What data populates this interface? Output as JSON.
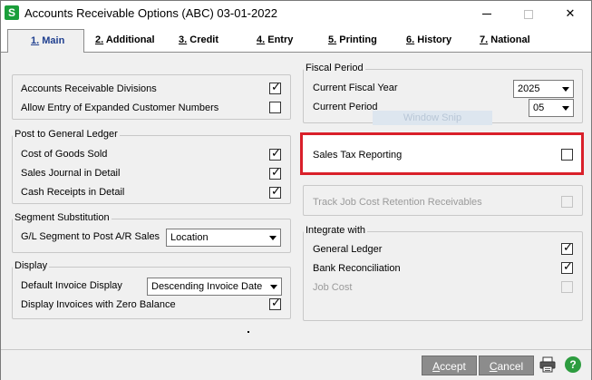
{
  "window": {
    "app_icon": "S",
    "title": "Accounts Receivable Options (ABC) 03-01-2022"
  },
  "tabs": [
    {
      "key": "1.",
      "label": " Main",
      "active": true
    },
    {
      "key": "2.",
      "label": " Additional"
    },
    {
      "key": "3.",
      "label": " Credit"
    },
    {
      "key": "4.",
      "label": " Entry"
    },
    {
      "key": "5.",
      "label": " Printing"
    },
    {
      "key": "6.",
      "label": " History"
    },
    {
      "key": "7.",
      "label": " National"
    }
  ],
  "general": {
    "ar_divisions_label": "Accounts Receivable Divisions",
    "ar_divisions_checked": true,
    "expanded_customer_label": "Allow Entry of Expanded Customer Numbers",
    "expanded_customer_checked": false
  },
  "post_gl": {
    "title": "Post to General Ledger",
    "cogs_label": "Cost of Goods Sold",
    "cogs_checked": true,
    "sales_journal_label": "Sales Journal in Detail",
    "sales_journal_checked": true,
    "cash_receipts_label": "Cash Receipts in Detail",
    "cash_receipts_checked": true
  },
  "segment": {
    "title": "Segment Substitution",
    "label": "G/L Segment to Post A/R Sales",
    "value": "Location"
  },
  "display": {
    "title": "Display",
    "default_invoice_label": "Default Invoice Display",
    "default_invoice_value": "Descending Invoice Date",
    "zero_balance_label": "Display Invoices with Zero Balance",
    "zero_balance_checked": true
  },
  "fiscal": {
    "title": "Fiscal Period",
    "year_label": "Current Fiscal Year",
    "year_value": "2025",
    "period_label": "Current Period",
    "period_value": "05"
  },
  "overlay": {
    "snip_text": "Window Snip"
  },
  "sales_tax": {
    "label": "Sales Tax Reporting",
    "checked": false
  },
  "job_cost_retention": {
    "label": "Track Job Cost Retention Receivables",
    "checked": false,
    "disabled": true
  },
  "integrate": {
    "title": "Integrate with",
    "gl_label": "General Ledger",
    "gl_checked": true,
    "bank_label": "Bank Reconciliation",
    "bank_checked": true,
    "job_cost_label": "Job Cost",
    "job_cost_checked": false,
    "job_cost_disabled": true
  },
  "footer": {
    "accept_underlined": "A",
    "accept_rest": "ccept",
    "cancel_underlined": "C",
    "cancel_rest": "ancel",
    "help_icon": "?"
  },
  "colors": {
    "highlight": "#d9202a",
    "button_bg": "#8c8c8c",
    "active_tab_text": "#1f3f8f",
    "app_icon": "#1a9e3a"
  }
}
